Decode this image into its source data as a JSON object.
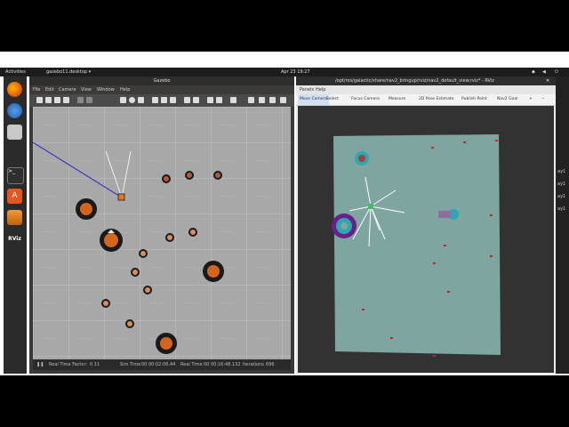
{
  "topbar": {
    "activities": "Activities",
    "app_menu": "gazebo11.desktop ▾",
    "clock": "Apr 23 19:27",
    "tray_icons": [
      "network-icon",
      "volume-icon",
      "power-icon"
    ]
  },
  "dock": {
    "items": [
      "firefox",
      "thunderbird",
      "files",
      "terminal",
      "software",
      "layers",
      "rviz"
    ],
    "rviz_label": "RViz"
  },
  "gazebo": {
    "title": "Gazebo",
    "menu": [
      "File",
      "Edit",
      "Camera",
      "View",
      "Window",
      "Help"
    ],
    "status": {
      "play_icon": "pause-icon",
      "rtf_label": "Real Time Factor:",
      "rtf_value": "0.11",
      "sim_label": "Sim Time",
      "sim_value": "00 00:02:06.44",
      "real_label": "Real Time",
      "real_value": "00 00:16:48.132",
      "iter_label": "Iterations",
      "iter_value": "696"
    }
  },
  "rviz": {
    "title": "/opt/ros/galactic/share/nav2_bringup/rviz/nav2_default_view.rviz* - RViz",
    "menu": [
      "Panels",
      "Help"
    ],
    "tools": [
      "Move Camera",
      "Select",
      "Focus Camera",
      "Measure",
      "2D Pose Estimate",
      "Publish Point",
      "Nav2 Goal"
    ]
  },
  "right_strip": [
    "ay1",
    "ay1",
    "ay1",
    "ay1"
  ]
}
